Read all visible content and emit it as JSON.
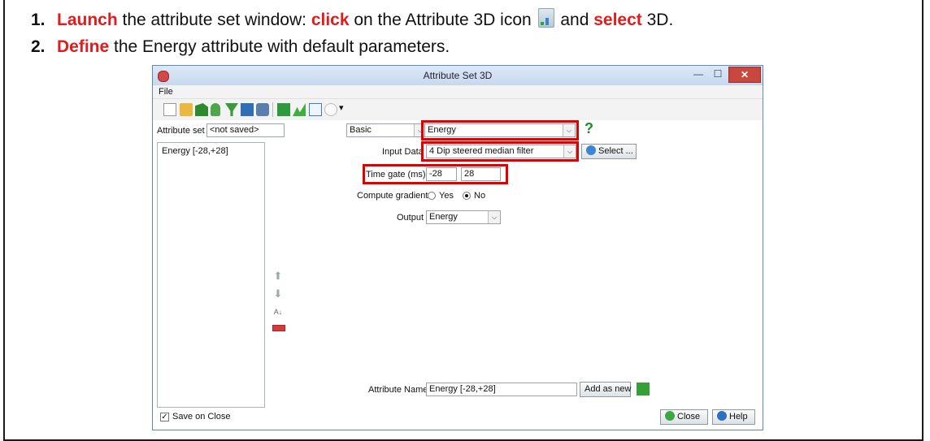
{
  "instructions": {
    "step1": {
      "num": "1.",
      "kw1": "Launch",
      "t1": " the attribute set window: ",
      "kw2": "click",
      "t2": " on the Attribute 3D icon ",
      "t3": " and ",
      "kw3": "select",
      "t4": " 3D."
    },
    "step2": {
      "num": "2.",
      "kw1": "Define",
      "t1": " the Energy attribute with default parameters."
    }
  },
  "window": {
    "title": "Attribute Set 3D",
    "menu_file": "File",
    "attribute_set_label": "Attribute set",
    "attribute_set_value": "<not saved>",
    "category": "Basic",
    "attribute_type": "Energy",
    "help_glyph": "?",
    "input_data_label": "Input Data",
    "input_data_value": "4 Dip steered median filter",
    "select_button": "Select ...",
    "time_gate_label": "Time gate (ms)",
    "time_gate_start": "-28",
    "time_gate_end": "28",
    "compute_gradient_label": "Compute gradient",
    "gradient_yes": "Yes",
    "gradient_no": "No",
    "gradient_selected": "No",
    "output_label": "Output",
    "output_value": "Energy",
    "attribute_list": [
      "Energy [-28,+28]"
    ],
    "attribute_name_label": "Attribute Name",
    "attribute_name_value": "Energy [-28,+28]",
    "add_as_new": "Add as new",
    "save_on_close_label": "Save on Close",
    "save_on_close_checked": true,
    "close_button": "Close",
    "help_button": "Help"
  },
  "colors": {
    "keyword": "#e31b1b",
    "highlight_box": "#e00000",
    "title_bar": "#c7d9ee"
  }
}
